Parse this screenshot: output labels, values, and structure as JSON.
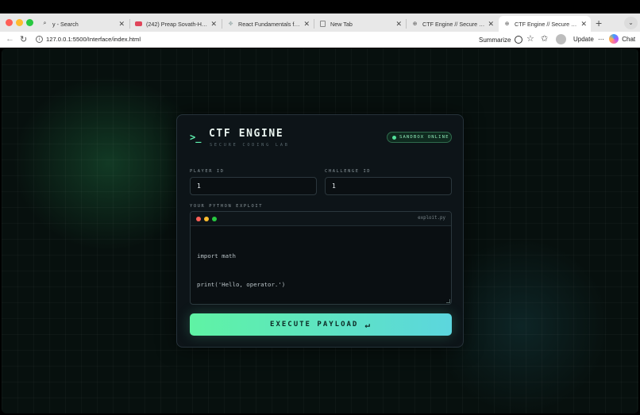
{
  "browser": {
    "tabs": [
      {
        "title": "y - Search",
        "favicon": "search-icon"
      },
      {
        "title": "(242) Preap Sovath-Him Sh",
        "favicon": "youtube-icon"
      },
      {
        "title": "React Fundamentals for Ne",
        "favicon": "react-icon"
      },
      {
        "title": "New Tab",
        "favicon": "page-icon"
      },
      {
        "title": "CTF Engine // Secure Coding",
        "favicon": "globe-icon"
      },
      {
        "title": "CTF Engine // Secure Coding",
        "favicon": "globe-icon",
        "active": true
      }
    ],
    "new_tab_glyph": "+",
    "close_glyph": "✕",
    "url": "127.0.0.1:5500/Interface/index.html",
    "summarize_label": "Summarize",
    "update_label": "Update",
    "chat_label": "Chat"
  },
  "app": {
    "prompt_glyph": ">_",
    "title": "CTF ENGINE",
    "subtitle": "SECURE CODING LAB",
    "status_badge": "SANDBOX ONLINE",
    "player_id_label": "PLAYER ID",
    "player_id_value": "1",
    "challenge_id_label": "CHALLENGE ID",
    "challenge_id_value": "1",
    "exploit_label": "YOUR PYTHON EXPLOIT",
    "editor_filename": "exploit.py",
    "code_lines": [
      "import math",
      "print('Hello, operator.')"
    ],
    "execute_label": "EXECUTE PAYLOAD",
    "execute_icon": "↵"
  },
  "colors": {
    "accent_green": "#5ff3a4",
    "accent_cyan": "#5cd6de",
    "status_dot": "#53e09b",
    "mac_red": "#ff5f57",
    "mac_yellow": "#febc2e",
    "mac_green": "#28c840"
  }
}
